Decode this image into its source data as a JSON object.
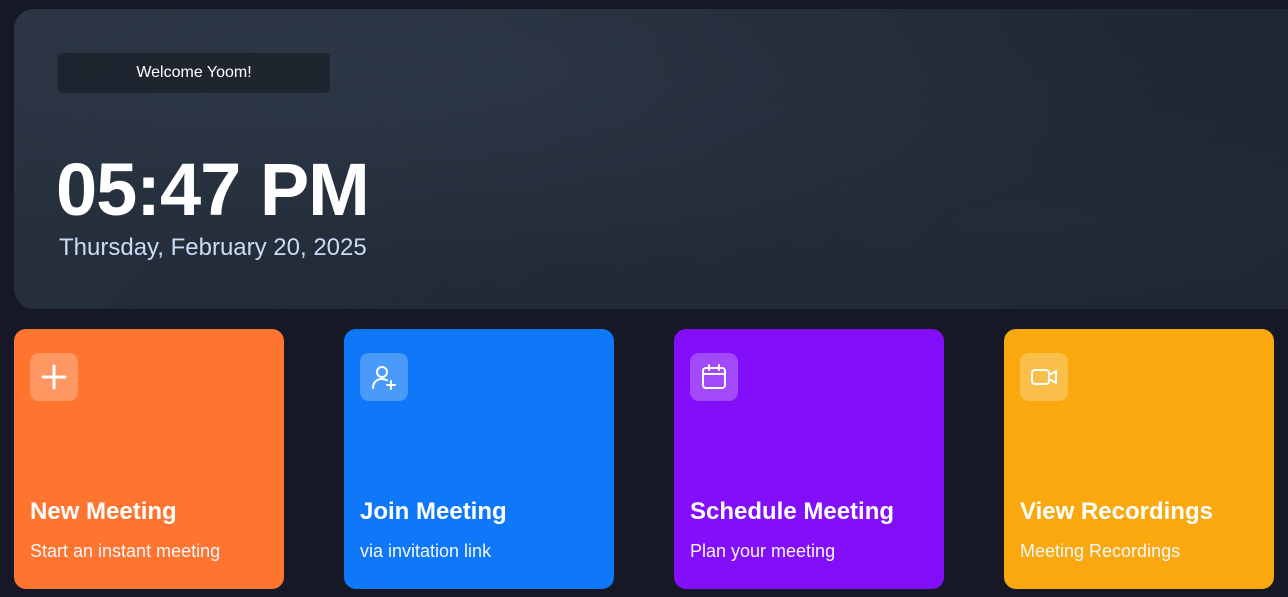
{
  "hero": {
    "welcome": "Welcome Yoom!",
    "time": "05:47 PM",
    "date": "Thursday, February 20, 2025"
  },
  "cards": [
    {
      "title": "New Meeting",
      "subtitle": "Start an instant meeting",
      "icon": "plus-icon",
      "color": "#ff742e"
    },
    {
      "title": "Join Meeting",
      "subtitle": "via invitation link",
      "icon": "user-add-icon",
      "color": "#0e78f9"
    },
    {
      "title": "Schedule Meeting",
      "subtitle": "Plan your meeting",
      "icon": "calendar-icon",
      "color": "#830ef9"
    },
    {
      "title": "View Recordings",
      "subtitle": "Meeting Recordings",
      "icon": "video-icon",
      "color": "#f9a90e"
    }
  ]
}
